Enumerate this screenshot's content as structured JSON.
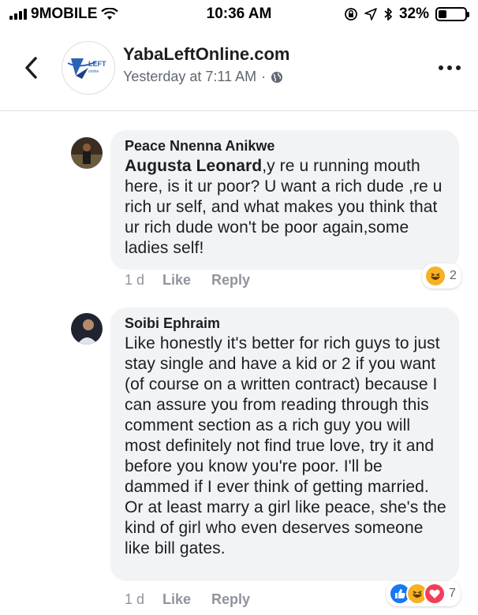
{
  "status_bar": {
    "carrier": "9MOBILE",
    "time": "10:36 AM",
    "battery_percent": "32%",
    "battery_level": 0.32
  },
  "header": {
    "page_name": "YabaLeftOnline.com",
    "timestamp": "Yesterday at 7:11 AM",
    "separator": "·",
    "logo_text": "LEFT"
  },
  "comments": [
    {
      "author": "Peace Nnenna Anikwe",
      "mention": "Augusta Leonard",
      "text": ",y re u running mouth here, is it ur poor? U want a rich dude ,re u rich ur self, and what makes you think that ur rich dude won't be poor again,some ladies self!",
      "time": "1 d",
      "like_label": "Like",
      "reply_label": "Reply",
      "reactions": [
        "haha"
      ],
      "reaction_count": "2"
    },
    {
      "author": "Soibi Ephraim",
      "text": "Like honestly it's better for rich guys to just stay single and have a kid or 2 if you want (of course on a written contract) because I can assure you from reading through this comment section as a rich guy you will most definitely not find true love, try it and before you know you're poor. I'll be dammed if I ever think of getting married. Or at least marry a girl like peace, she's the kind of girl who even deserves someone like bill gates.",
      "time": "1 d",
      "like_label": "Like",
      "reply_label": "Reply",
      "reactions": [
        "like",
        "haha",
        "love"
      ],
      "reaction_count": "7"
    }
  ],
  "colors": {
    "bubble": "#f2f3f5",
    "muted": "#90949c",
    "like_blue": "#1877f2",
    "love_red": "#f33e58",
    "haha_yellow": "#f7b125"
  }
}
